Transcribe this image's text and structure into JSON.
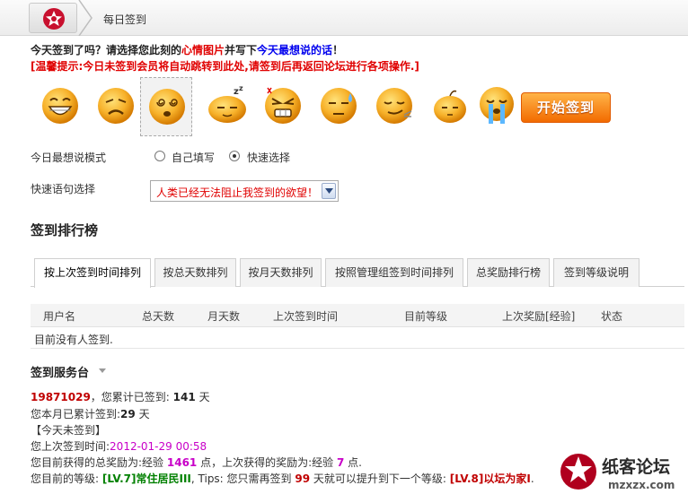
{
  "breadcrumb": {
    "current": "每日签到"
  },
  "prompt": {
    "part1": "今天签到了吗？请选择您此刻的",
    "part2": "心情图片",
    "part3": "并写下",
    "part4": "今天最想说的话",
    "part5": "！",
    "warning": "[温馨提示:今日未签到会员将自动跳转到此处,请签到后再返回论坛进行各项操作.]"
  },
  "moods": [
    {
      "icon": "grin-face-icon"
    },
    {
      "icon": "sad-face-icon"
    },
    {
      "icon": "dizzy-face-icon",
      "selected": true
    },
    {
      "icon": "sleepy-face-icon"
    },
    {
      "icon": "angry-face-icon"
    },
    {
      "icon": "sweat-face-icon"
    },
    {
      "icon": "smug-face-icon"
    },
    {
      "icon": "shy-face-icon"
    },
    {
      "icon": "crying-face-icon"
    }
  ],
  "start_button": "开始签到",
  "mode": {
    "label": "今日最想说模式",
    "option_self": "自己填写",
    "option_quick": "快速选择",
    "selected": "快速选择"
  },
  "quick": {
    "label": "快速语句选择",
    "value": "人类已经无法阻止我签到的欲望！"
  },
  "ranking": {
    "title": "签到排行榜",
    "tabs": [
      "按上次签到时间排列",
      "按总天数排列",
      "按月天数排列",
      "按照管理组签到时间排列",
      "总奖励排行榜",
      "签到等级说明"
    ],
    "active_tab": 0,
    "columns": [
      "用户名",
      "总天数",
      "月天数",
      "上次签到时间",
      "目前等级",
      "上次奖励[经验]",
      "状态"
    ],
    "empty_text": "目前没有人签到."
  },
  "service": {
    "title": "签到服务台",
    "username": "19871029",
    "total_text_a": "，您累计已签到:",
    "total_days": "141",
    "total_text_b": "天",
    "month_text_a": "您本月已累计签到:",
    "month_days": "29",
    "month_text_b": "天",
    "today_status": "【今天未签到】",
    "last_time_label": "您上次签到时间:",
    "last_time": "2012-01-29 00:58",
    "reward_a": "您目前获得的总奖励为:经验",
    "reward_total": "1461",
    "reward_b": "点，上次获得的奖励为:经验",
    "reward_last": "7",
    "reward_c": "点.",
    "level_a": "您目前的等级:",
    "level_current": "[LV.7]常住居民III",
    "level_b": ", Tips: 您只需再签到",
    "level_days": "99",
    "level_c": "天就可以提升到下一个等级:",
    "level_next": "[LV.8]以坛为家I",
    "level_d": "."
  },
  "watermark": {
    "title": "纸客论坛",
    "url": "mzxzx.com"
  },
  "colors": {
    "accent_red": "#e00000",
    "button_orange": "#f26b00",
    "magenta": "#c800c8",
    "green": "#008000"
  }
}
